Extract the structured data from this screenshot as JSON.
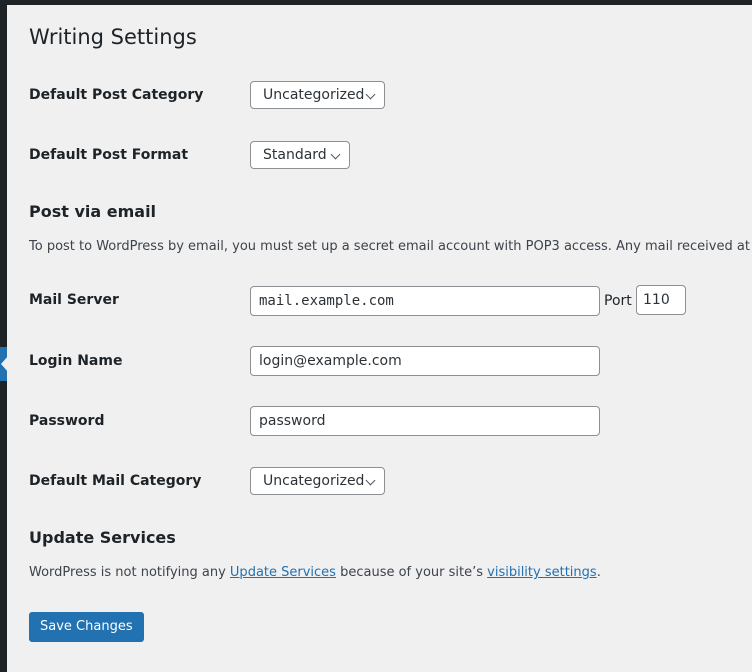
{
  "page": {
    "title": "Writing Settings"
  },
  "fields": {
    "default_post_category": {
      "label": "Default Post Category",
      "value": "Uncategorized"
    },
    "default_post_format": {
      "label": "Default Post Format",
      "value": "Standard"
    }
  },
  "post_via_email": {
    "heading": "Post via email",
    "description": "To post to WordPress by email, you must set up a secret email account with POP3 access. Any mail received at this address will be posted,",
    "mail_server": {
      "label": "Mail Server",
      "value": "mail.example.com",
      "port_label": "Port",
      "port_value": "110"
    },
    "login_name": {
      "label": "Login Name",
      "value": "login@example.com"
    },
    "password": {
      "label": "Password",
      "value": "password"
    },
    "default_mail_category": {
      "label": "Default Mail Category",
      "value": "Uncategorized"
    }
  },
  "update_services": {
    "heading": "Update Services",
    "text_before": "WordPress is not notifying any ",
    "link_update_services": "Update Services",
    "text_middle": " because of your site’s ",
    "link_visibility": "visibility settings",
    "text_after": "."
  },
  "actions": {
    "save_label": "Save Changes"
  },
  "colors": {
    "accent": "#2271b1",
    "admin_bar": "#1d2327",
    "background": "#f0f0f1"
  }
}
